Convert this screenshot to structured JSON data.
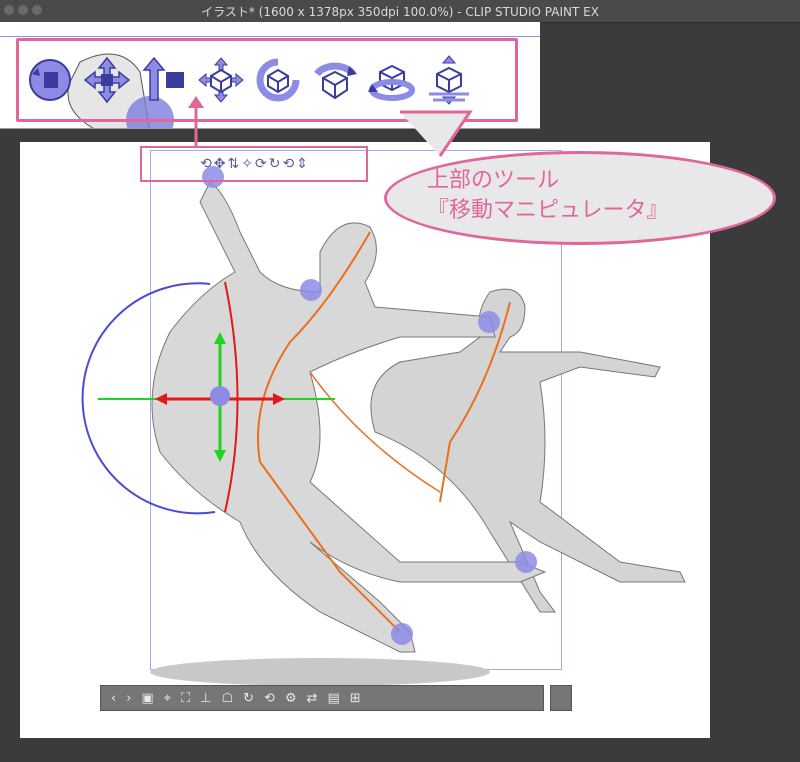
{
  "window": {
    "title": "イラスト* (1600 x 1378px 350dpi 100.0%)  - CLIP STUDIO PAINT EX"
  },
  "callout": {
    "line1": "上部のツール",
    "line2": "『移動マニピュレータ』"
  },
  "colors": {
    "highlight": "#e0679a",
    "tool_icon": "#7d7ddd",
    "callout_bg": "#e8e8e8",
    "canvas_bg": "#ffffff",
    "workspace_bg": "#3b3b3b"
  },
  "manipulator_tools": [
    {
      "name": "rotate-camera-icon"
    },
    {
      "name": "pan-camera-icon"
    },
    {
      "name": "move-camera-forward-icon"
    },
    {
      "name": "move-plane-icon"
    },
    {
      "name": "rotate-plane-icon"
    },
    {
      "name": "rotate-view-icon"
    },
    {
      "name": "rotate-object-icon"
    },
    {
      "name": "move-object-along-plane-icon"
    }
  ],
  "bottom_bar": {
    "prev": "‹",
    "next": "›"
  }
}
